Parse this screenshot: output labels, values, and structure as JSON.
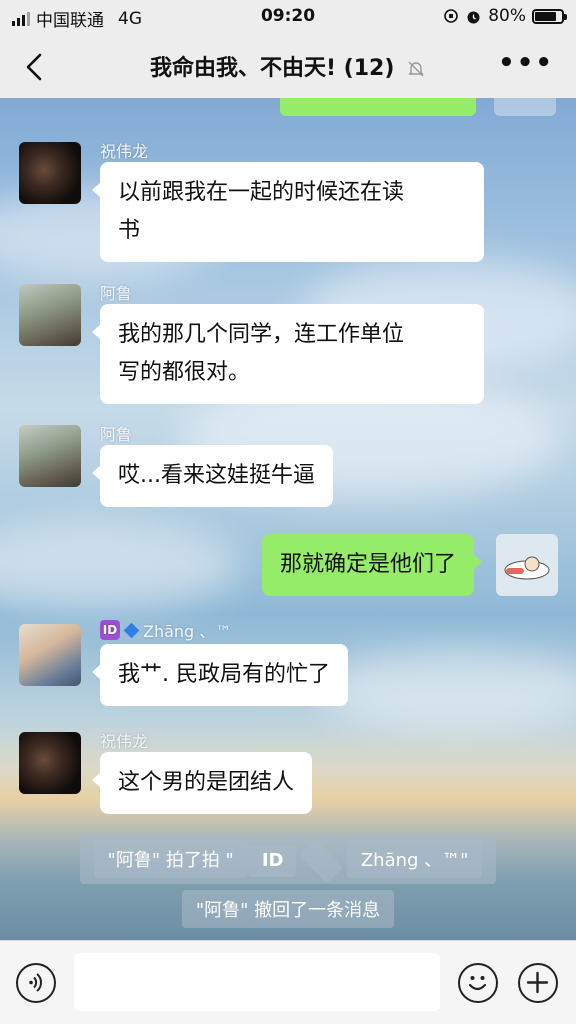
{
  "status_bar": {
    "carrier": "中国联通",
    "network": "4G",
    "time": "09:20",
    "battery_percent": "80%",
    "battery_level": 0.8
  },
  "nav": {
    "title": "我命由我、不由天! (12)",
    "back_icon": "chevron-left-icon",
    "mute_icon": "bell-off-icon",
    "more_icon": "more-icon"
  },
  "messages": [
    {
      "sender": "祝伟龙",
      "lines": [
        "以前跟我在一起的时候还在读",
        "书"
      ]
    },
    {
      "sender": "阿鲁",
      "lines": [
        "我的那几个同学，连工作单位",
        "写的都很对。"
      ]
    },
    {
      "sender": "阿鲁",
      "lines": [
        "哎...看来这娃挺牛逼"
      ]
    },
    {
      "sender": "",
      "lines": [
        "那就确定是他们了"
      ],
      "outgoing": true
    },
    {
      "sender": "Zhāng 、™",
      "lines": [
        "我艹. 民政局有的忙了"
      ]
    },
    {
      "sender": "祝伟龙",
      "lines": [
        "这个男的是团结人"
      ]
    }
  ],
  "system_notices": {
    "pat_prefix": "\"阿鲁\" 拍了拍 \"",
    "pat_target": "Zhāng 、™\"",
    "recall": "\"阿鲁\" 撤回了一条消息"
  },
  "id_badge_text": "ID",
  "input_bar": {
    "voice_icon": "voice-icon",
    "emoji_icon": "emoji-icon",
    "plus_icon": "plus-icon"
  },
  "colors": {
    "outgoing_bubble": "#95ec69",
    "incoming_bubble": "#ffffff",
    "bar_bg": "#ededed"
  }
}
